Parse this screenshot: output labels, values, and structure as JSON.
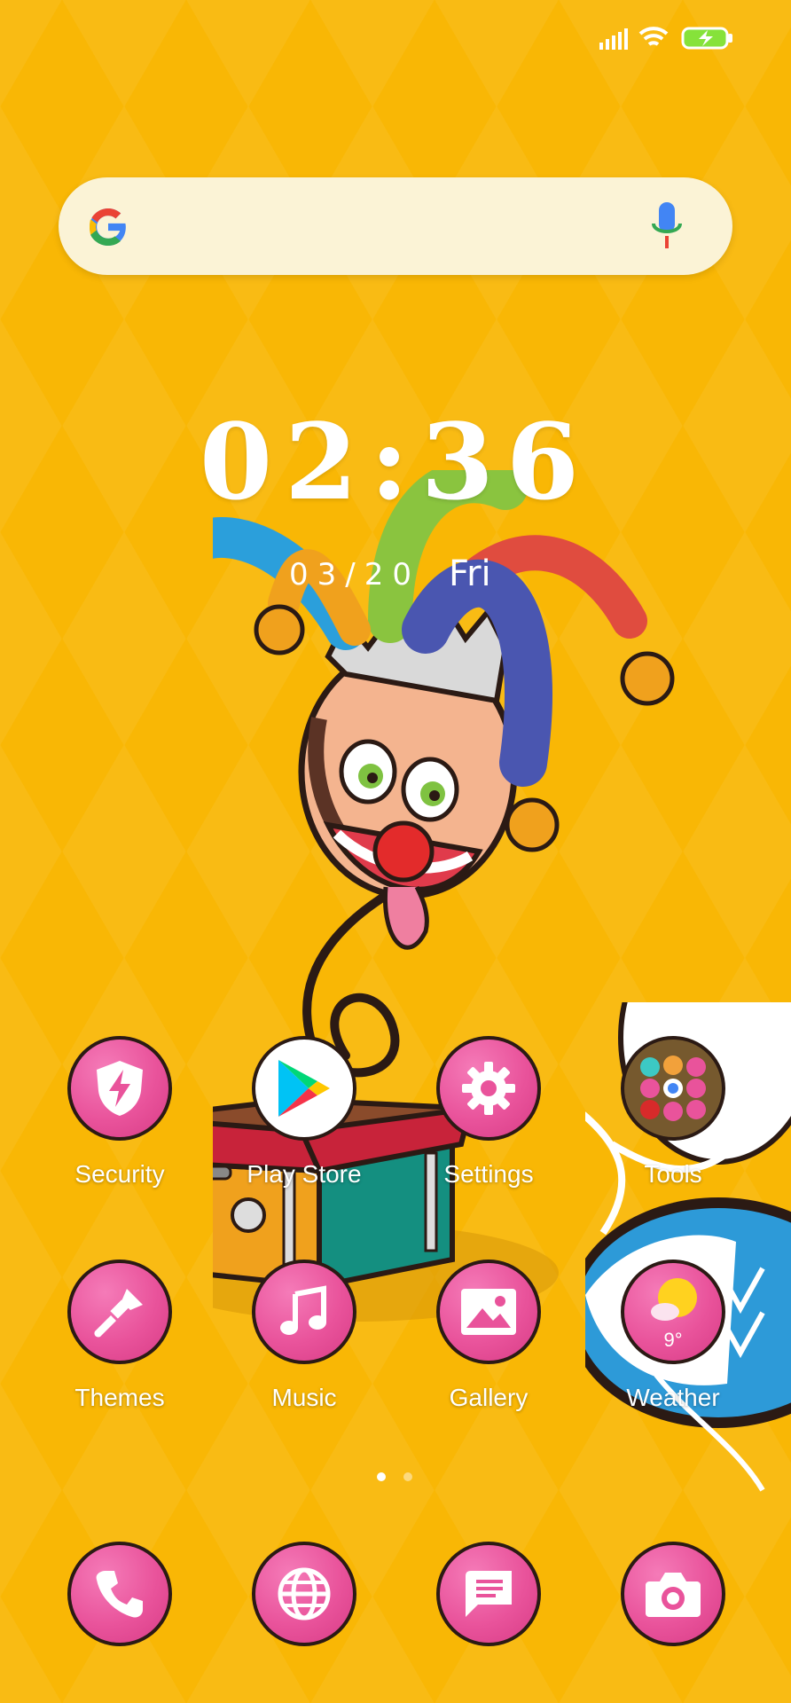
{
  "status_bar": {
    "signal_icon": "cellular-signal-icon",
    "wifi_icon": "wifi-icon",
    "battery_icon": "battery-charging-icon"
  },
  "search": {
    "logo_icon": "google-logo-icon",
    "mic_icon": "mic-icon"
  },
  "clock": {
    "time": "02:36",
    "date": "03/20",
    "day": "Fri"
  },
  "apps_row1": [
    {
      "label": "Security",
      "icon": "shield-lightning-icon"
    },
    {
      "label": "Play Store",
      "icon": "play-store-icon"
    },
    {
      "label": "Settings",
      "icon": "gear-icon"
    },
    {
      "label": "Tools",
      "icon": "folder-icon"
    }
  ],
  "apps_row2": [
    {
      "label": "Themes",
      "icon": "paintbrush-icon"
    },
    {
      "label": "Music",
      "icon": "music-note-icon"
    },
    {
      "label": "Gallery",
      "icon": "image-icon"
    },
    {
      "label": "Weather",
      "icon": "weather-sun-cloud-icon",
      "temp": "9°"
    }
  ],
  "page_indicator": {
    "pages": 2,
    "current": 1
  },
  "dock": [
    {
      "icon": "phone-icon"
    },
    {
      "icon": "browser-globe-icon"
    },
    {
      "icon": "messages-icon"
    },
    {
      "icon": "camera-icon"
    }
  ],
  "colors": {
    "background": "#f9b705",
    "icon_pink": "#e9539b",
    "icon_outline": "#2b1a14"
  }
}
